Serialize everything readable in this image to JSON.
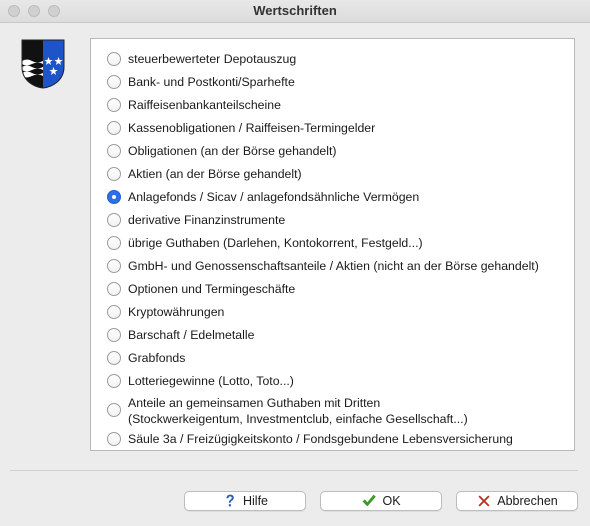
{
  "window": {
    "title": "Wertschriften"
  },
  "options": [
    {
      "label": "steuerbewerteter Depotauszug",
      "checked": false
    },
    {
      "label": "Bank- und Postkonti/Sparhefte",
      "checked": false
    },
    {
      "label": "Raiffeisenbankanteilscheine",
      "checked": false
    },
    {
      "label": "Kassenobligationen / Raiffeisen-Termingelder",
      "checked": false
    },
    {
      "label": "Obligationen (an der Börse gehandelt)",
      "checked": false
    },
    {
      "label": "Aktien (an der Börse gehandelt)",
      "checked": false
    },
    {
      "label": "Anlagefonds / Sicav / anlagefondsähnliche Vermögen",
      "checked": true
    },
    {
      "label": "derivative Finanzinstrumente",
      "checked": false
    },
    {
      "label": "übrige Guthaben (Darlehen, Kontokorrent, Festgeld...)",
      "checked": false
    },
    {
      "label": "GmbH- und Genossenschaftsanteile / Aktien (nicht an der Börse gehandelt)",
      "checked": false
    },
    {
      "label": "Optionen und Termingeschäfte",
      "checked": false
    },
    {
      "label": "Kryptowährungen",
      "checked": false
    },
    {
      "label": "Barschaft / Edelmetalle",
      "checked": false
    },
    {
      "label": "Grabfonds",
      "checked": false
    },
    {
      "label": "Lotteriegewinne (Lotto, Toto...)",
      "checked": false
    },
    {
      "label": "Anteile an gemeinsamen Guthaben mit Dritten\n(Stockwerkeigentum, Investmentclub, einfache Gesellschaft...)",
      "checked": false
    },
    {
      "label": "Säule 3a / Freizügigkeitskonto / Fondsgebundene Lebensversicherung",
      "checked": false
    }
  ],
  "buttons": {
    "help": "Hilfe",
    "ok": "OK",
    "cancel": "Abbrechen"
  },
  "colors": {
    "accent": "#2e6fe8",
    "ok_check": "#3a9a2a",
    "cancel_x": "#b3341e",
    "help_icon": "#2d5fb0"
  },
  "icons": {
    "logo": "canton-aargau-coat-of-arms-icon",
    "help": "question-mark-icon",
    "ok": "checkmark-icon",
    "cancel": "x-icon"
  }
}
